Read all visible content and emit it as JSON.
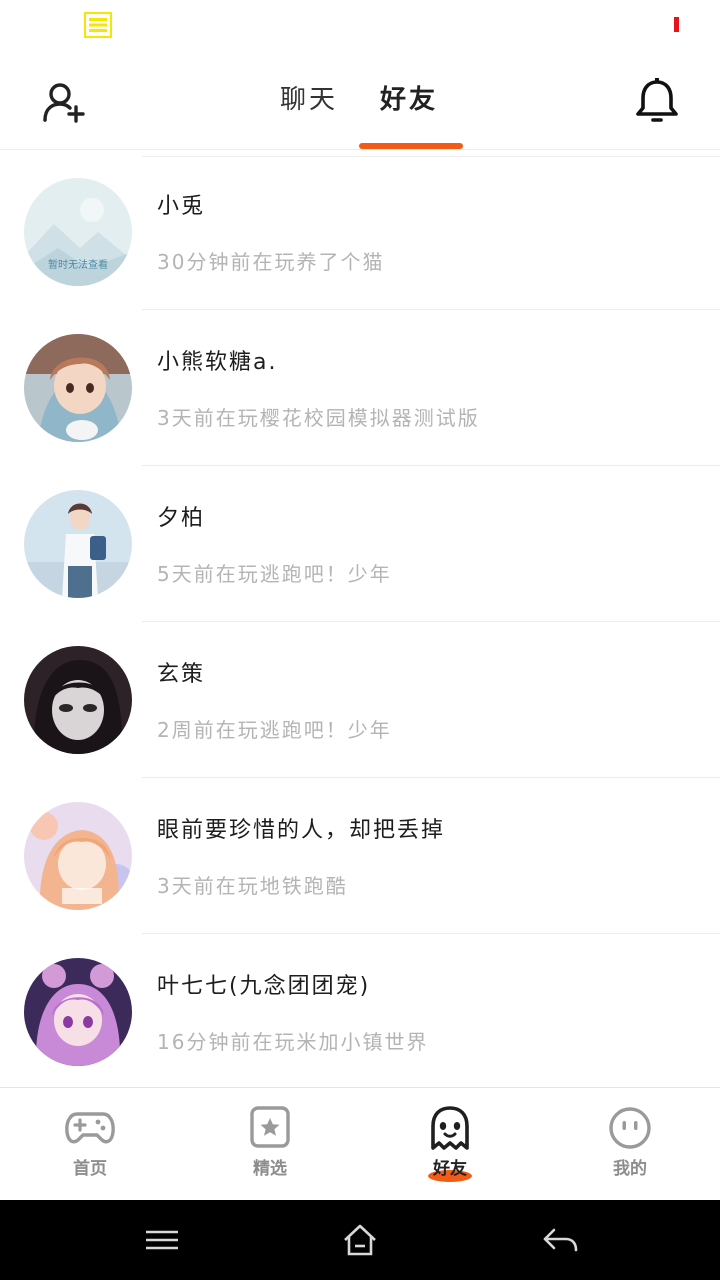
{
  "colors": {
    "accent": "#f25c16",
    "status_icon": "#f7e600",
    "status_red": "#e8121b",
    "nav_bar": "#000000"
  },
  "status_bar": {
    "left_icon": "menu-lines-icon",
    "right_indicator": "red-bar"
  },
  "header": {
    "add_friend_icon": "add-user-icon",
    "tabs": [
      {
        "label": "聊天",
        "active": false
      },
      {
        "label": "好友",
        "active": true
      }
    ],
    "notification_icon": "bell-icon"
  },
  "friends": [
    {
      "name": "小兎",
      "activity": "30分钟前在玩养了个猫",
      "avatar_placeholder_text": "暂时无法查看"
    },
    {
      "name": "小熊软糖a.",
      "activity": "3天前在玩樱花校园模拟器测试版"
    },
    {
      "name": "夕柏",
      "activity": "5天前在玩逃跑吧！少年"
    },
    {
      "name": "玄策",
      "activity": "2周前在玩逃跑吧！少年"
    },
    {
      "name": "眼前要珍惜的人，却把丢掉",
      "activity": "3天前在玩地铁跑酷"
    },
    {
      "name": "叶七七(九念团团宠)",
      "activity": "16分钟前在玩米加小镇世界"
    }
  ],
  "bottom_nav": [
    {
      "label": "首页",
      "icon": "gamepad-icon",
      "active": false
    },
    {
      "label": "精选",
      "icon": "star-badge-icon",
      "active": false
    },
    {
      "label": "好友",
      "icon": "ghost-icon",
      "active": true
    },
    {
      "label": "我的",
      "icon": "smiley-icon",
      "active": false
    }
  ],
  "system_nav": [
    "menu-icon",
    "home-icon",
    "back-icon"
  ]
}
